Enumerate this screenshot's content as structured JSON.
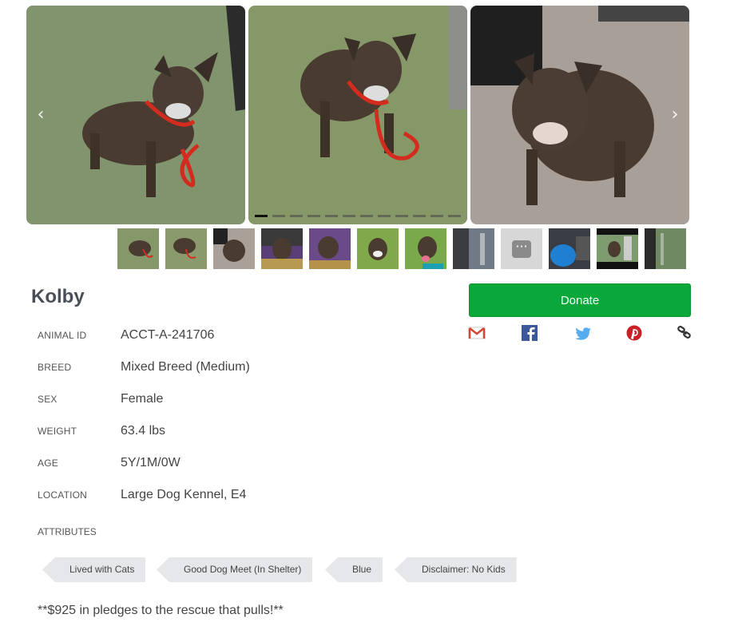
{
  "carousel": {
    "prev_arrow": "‹",
    "next_arrow": "›",
    "slide_count": 12,
    "active_slide": 1
  },
  "thumbnails": {
    "count": 12,
    "more_glyph": "···"
  },
  "animal": {
    "name": "Kolby",
    "fields": [
      {
        "label": "ANIMAL ID",
        "value": "ACCT-A-241706"
      },
      {
        "label": "BREED",
        "value": "Mixed Breed (Medium)"
      },
      {
        "label": "SEX",
        "value": "Female"
      },
      {
        "label": "WEIGHT",
        "value": "63.4 lbs"
      },
      {
        "label": "AGE",
        "value": "5Y/1M/0W"
      },
      {
        "label": "LOCATION",
        "value": "Large Dog Kennel, E4"
      }
    ],
    "attributes_label": "ATTRIBUTES",
    "attributes": [
      "Lived with Cats",
      "Good Dog Meet (In Shelter)",
      "Blue",
      "Disclaimer: No Kids"
    ],
    "note": "**$925 in pledges to the rescue that pulls!**"
  },
  "donate": {
    "label": "Donate"
  },
  "share": {
    "icons": [
      "gmail-icon",
      "facebook-icon",
      "twitter-icon",
      "pinterest-icon",
      "link-icon"
    ]
  },
  "colors": {
    "donate_bg": "#0aa83a",
    "tag_bg": "#e6e7ea",
    "title": "#4a4f57",
    "facebook": "#3b5998",
    "twitter": "#55acee",
    "pinterest": "#cb2027",
    "gmail": "#d44638"
  }
}
